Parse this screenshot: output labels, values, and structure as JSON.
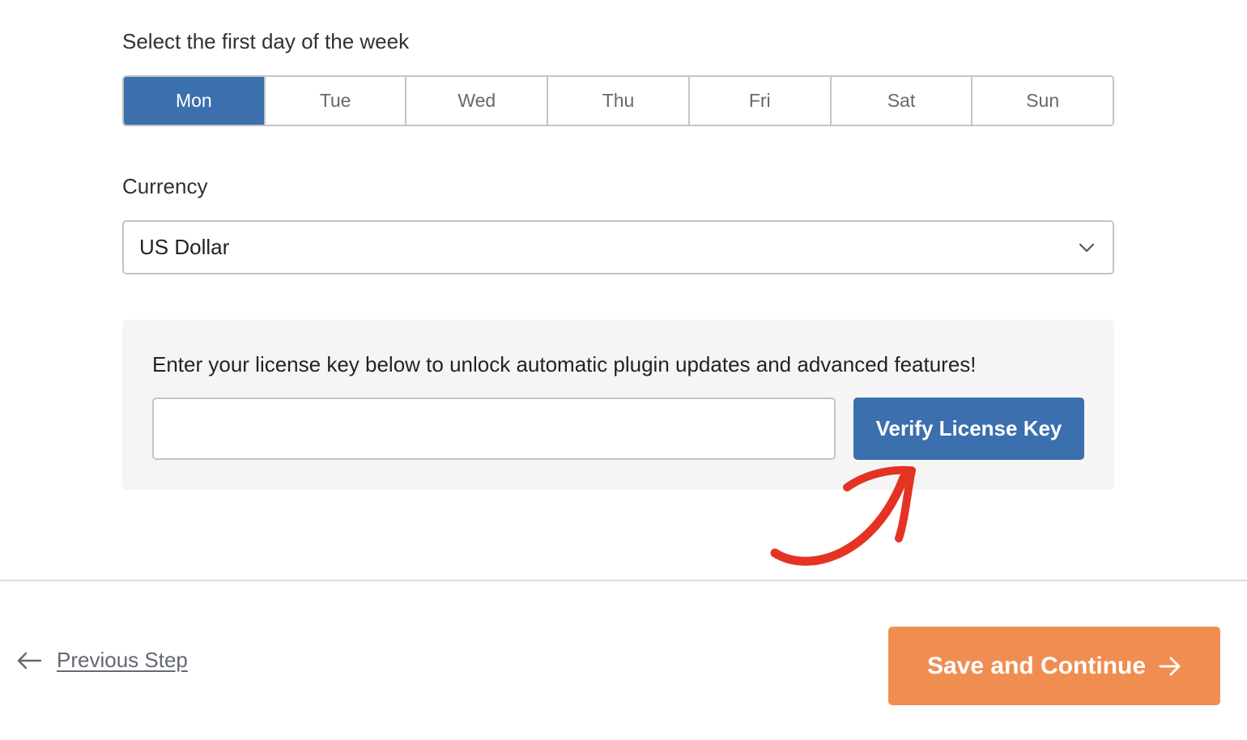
{
  "week": {
    "label": "Select the first day of the week",
    "selected": "Mon",
    "days": [
      "Mon",
      "Tue",
      "Wed",
      "Thu",
      "Fri",
      "Sat",
      "Sun"
    ]
  },
  "currency": {
    "label": "Currency",
    "value": "US Dollar",
    "icon": "chevron-down-icon"
  },
  "license": {
    "prompt": "Enter your license key below to unlock automatic plugin updates and advanced features!",
    "input_value": "",
    "verify_label": "Verify License Key"
  },
  "annotation": {
    "icon": "curved-arrow-icon",
    "color": "#e53323"
  },
  "footer": {
    "previous_label": "Previous Step",
    "previous_icon": "arrow-left-icon",
    "save_label": "Save and Continue",
    "save_icon": "arrow-right-icon"
  },
  "colors": {
    "primary": "#3b6fad",
    "accent": "#f08e52",
    "annotation": "#e53323"
  }
}
